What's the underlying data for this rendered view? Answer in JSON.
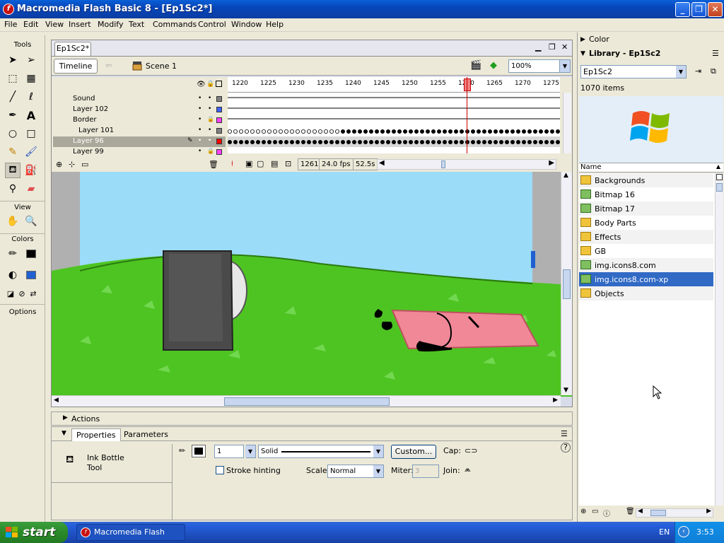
{
  "window": {
    "title": "Macromedia Flash Basic 8 - [Ep1Sc2*]",
    "minimize": "_",
    "restore": "❐",
    "close": "✕"
  },
  "menu": [
    "File",
    "Edit",
    "View",
    "Insert",
    "Modify",
    "Text",
    "Commands",
    "Control",
    "Window",
    "Help"
  ],
  "tools": {
    "title": "Tools",
    "view_label": "View",
    "colors_label": "Colors",
    "options_label": "Options"
  },
  "document": {
    "tab": "Ep1Sc2*",
    "timeline_button": "Timeline",
    "scene": "Scene 1",
    "zoom": "100%"
  },
  "timeline": {
    "layers": [
      {
        "name": "Sound",
        "color": "#808080"
      },
      {
        "name": "Layer 102",
        "color": "#4060ff"
      },
      {
        "name": "Border",
        "color": "#ff40ff"
      },
      {
        "name": "Layer 101",
        "color": "#808080"
      },
      {
        "name": "Layer 96",
        "color": "#ff0000"
      },
      {
        "name": "Layer 99",
        "color": "#ff40ff"
      }
    ],
    "selected_layer": "Layer 96",
    "ruler": [
      "1220",
      "1225",
      "1230",
      "1235",
      "1240",
      "1245",
      "1250",
      "1255",
      "1260",
      "1265",
      "1270",
      "1275"
    ],
    "current_frame": "1261",
    "fps": "24.0 fps",
    "elapsed": "52.5s"
  },
  "actions_label": "Actions",
  "properties": {
    "tabs": [
      "Properties",
      "Parameters"
    ],
    "tool_name": "Ink Bottle",
    "tool_sub": "Tool",
    "stroke_height": "1",
    "stroke_style": "Solid",
    "custom_button": "Custom...",
    "cap_label": "Cap:",
    "stroke_hinting_label": "Stroke hinting",
    "scale_label": "Scale:",
    "scale_value": "Normal",
    "miter_label": "Miter:",
    "miter_value": "3",
    "join_label": "Join:"
  },
  "right_panel": {
    "color_label": "Color",
    "library_label": "Library - Ep1Sc2",
    "library_doc": "Ep1Sc2",
    "item_count": "1070 items",
    "name_header": "Name",
    "items": [
      {
        "label": "Backgrounds",
        "type": "folder"
      },
      {
        "label": "Bitmap 16",
        "type": "bitmap"
      },
      {
        "label": "Bitmap 17",
        "type": "bitmap"
      },
      {
        "label": "Body Parts",
        "type": "folder"
      },
      {
        "label": "Effects",
        "type": "folder"
      },
      {
        "label": "GB",
        "type": "folder"
      },
      {
        "label": "img.icons8.com",
        "type": "bitmap"
      },
      {
        "label": "img.icons8.com-xp",
        "type": "bitmap"
      },
      {
        "label": "Objects",
        "type": "folder"
      }
    ],
    "selected_item": "img.icons8.com-xp"
  },
  "taskbar": {
    "start": "start",
    "task": "Macromedia Flash Ba...",
    "lang": "EN",
    "clock": "3:53"
  }
}
